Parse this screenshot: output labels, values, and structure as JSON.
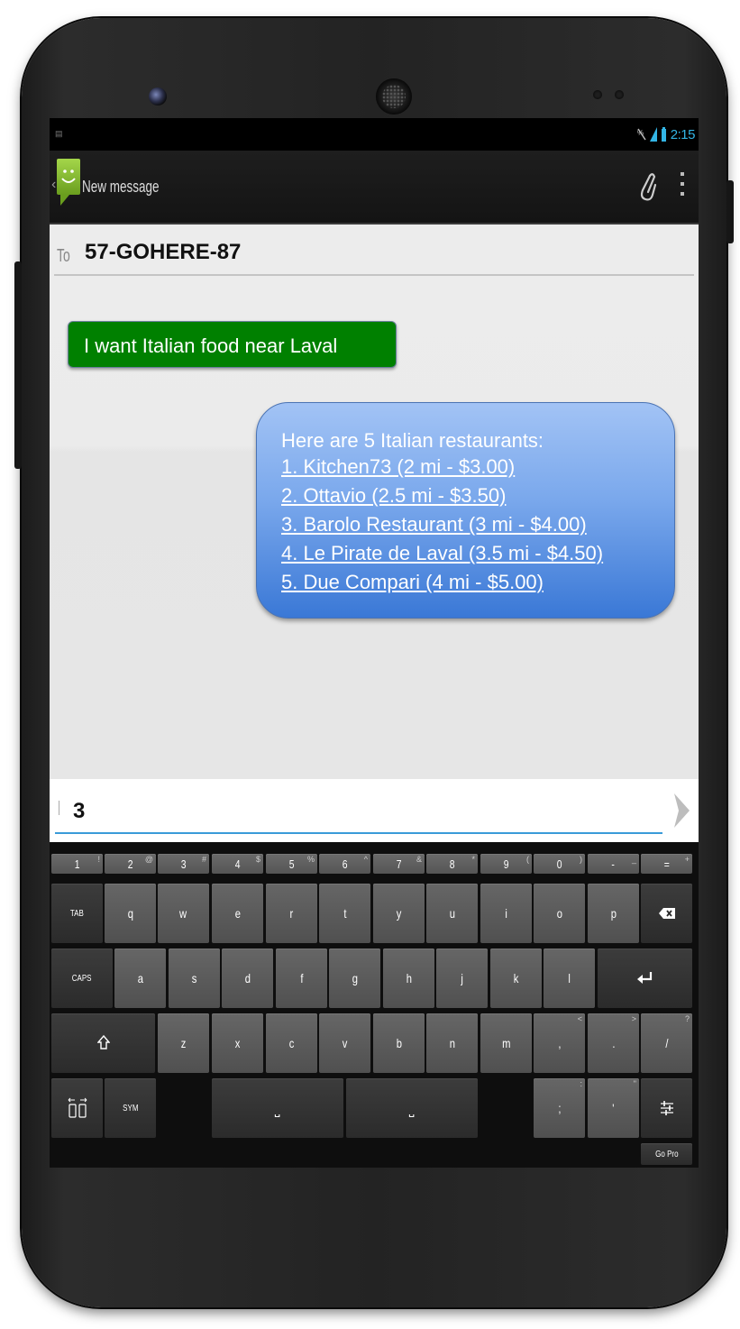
{
  "status_bar": {
    "time": "2:15"
  },
  "action_bar": {
    "title": "New message"
  },
  "recipient": {
    "label": "To",
    "value": "57-GOHERE-87"
  },
  "messages": {
    "sent": "I want Italian food near Laval",
    "received_intro": "Here are 5 Italian restaurants:",
    "received_links": [
      "1. Kitchen73 (2 mi - $3.00)",
      "2. Ottavio (2.5 mi - $3.50)",
      "3. Barolo Restaurant (3 mi - $4.00)",
      "4. Le Pirate de Laval (3.5 mi - $4.50)",
      "5. Due Compari (4 mi - $5.00)"
    ]
  },
  "composer": {
    "value": "3"
  },
  "keyboard": {
    "number_row": [
      {
        "main": "1",
        "sub": "!"
      },
      {
        "main": "2",
        "sub": "@"
      },
      {
        "main": "3",
        "sub": "#"
      },
      {
        "main": "4",
        "sub": "$"
      },
      {
        "main": "5",
        "sub": "%"
      },
      {
        "main": "6",
        "sub": "^"
      },
      {
        "main": "7",
        "sub": "&"
      },
      {
        "main": "8",
        "sub": "*"
      },
      {
        "main": "9",
        "sub": "("
      },
      {
        "main": "0",
        "sub": ")"
      },
      {
        "main": "-",
        "sub": "_"
      },
      {
        "main": "=",
        "sub": "+"
      }
    ],
    "tab": "TAB",
    "row1": [
      "q",
      "w",
      "e",
      "r",
      "t",
      "y",
      "u",
      "i",
      "o",
      "p"
    ],
    "caps": "CAPS",
    "row2": [
      "a",
      "s",
      "d",
      "f",
      "g",
      "h",
      "j",
      "k",
      "l"
    ],
    "row3": [
      "z",
      "x",
      "c",
      "v",
      "b",
      "n",
      "m"
    ],
    "row3_punct": [
      {
        "main": ",",
        "sub": "<"
      },
      {
        "main": ".",
        "sub": ">"
      },
      {
        "main": "/",
        "sub": "?"
      }
    ],
    "sym": "SYM",
    "bottom_punct": [
      {
        "main": ";",
        "sub": ":"
      },
      {
        "main": "'",
        "sub": "\""
      }
    ],
    "go_pro": "Go Pro"
  }
}
